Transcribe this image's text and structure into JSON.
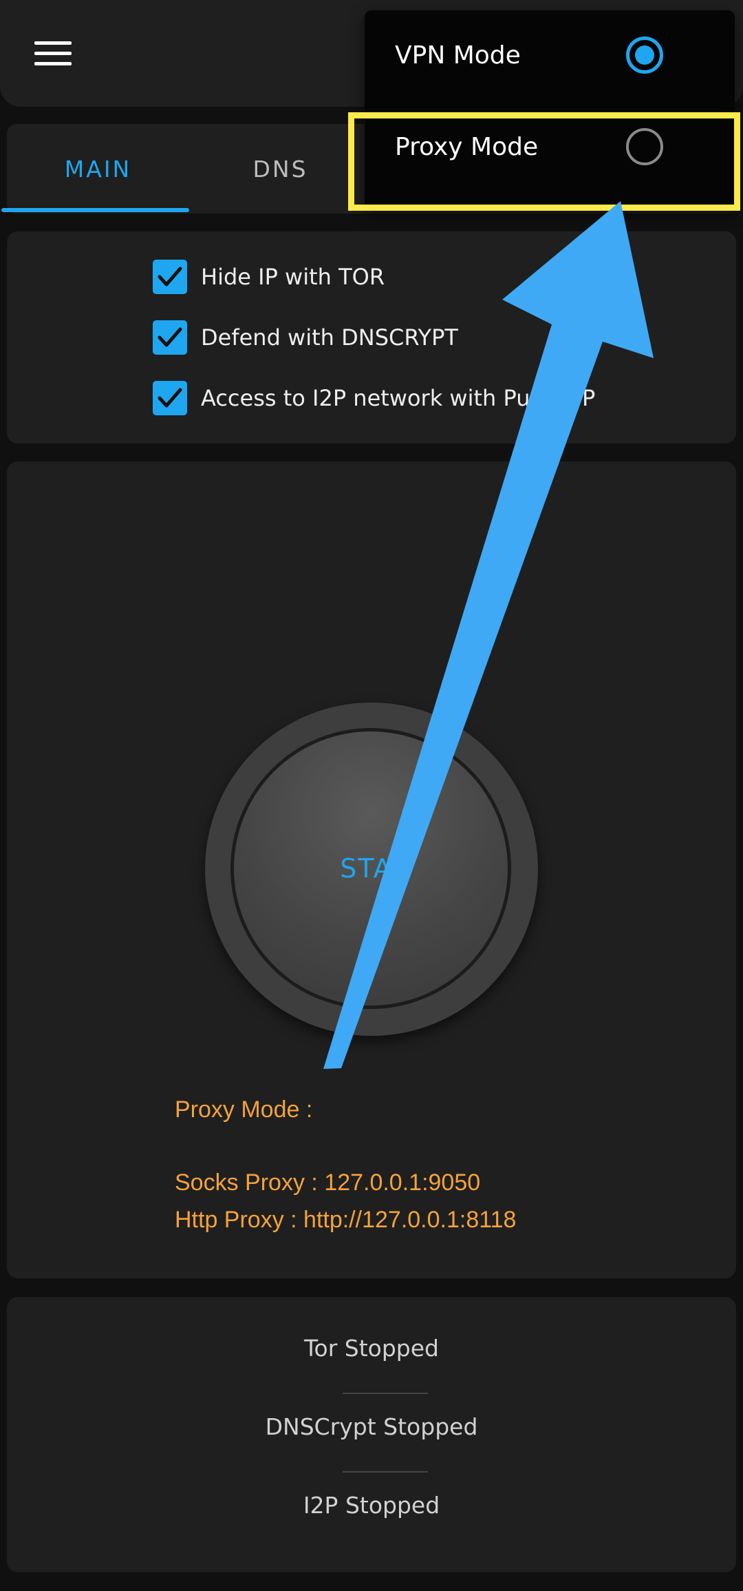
{
  "toolbar": {
    "menu_icon": "hamburger-menu-icon"
  },
  "tabs": [
    {
      "label": "MAIN",
      "selected": true
    },
    {
      "label": "DNS",
      "selected": false
    }
  ],
  "options": [
    {
      "label": "Hide IP with TOR",
      "checked": true
    },
    {
      "label": "Defend with DNSCRYPT",
      "checked": true
    },
    {
      "label": "Access to I2P network with Purr",
      "trailing_label": "P",
      "checked": true
    }
  ],
  "start_button": {
    "label": "STAI"
  },
  "proxy_info": {
    "mode_label": "Proxy Mode :",
    "socks_label": "Socks Proxy :  127.0.0.1:9050",
    "http_label": "Http Proxy  :  http://127.0.0.1:8118"
  },
  "status": [
    "Tor Stopped",
    "DNSCrypt Stopped",
    "I2P Stopped"
  ],
  "mode_menu": {
    "items": [
      {
        "label": "VPN Mode",
        "selected": true
      },
      {
        "label": "Proxy Mode",
        "selected": false
      }
    ]
  },
  "colors": {
    "accent": "#1fa6f0",
    "proxy_text": "#f4a23c",
    "highlight": "#fce94b",
    "annotation_arrow": "#3fa9f5",
    "panel": "#1f1f1f",
    "background": "#101010"
  }
}
